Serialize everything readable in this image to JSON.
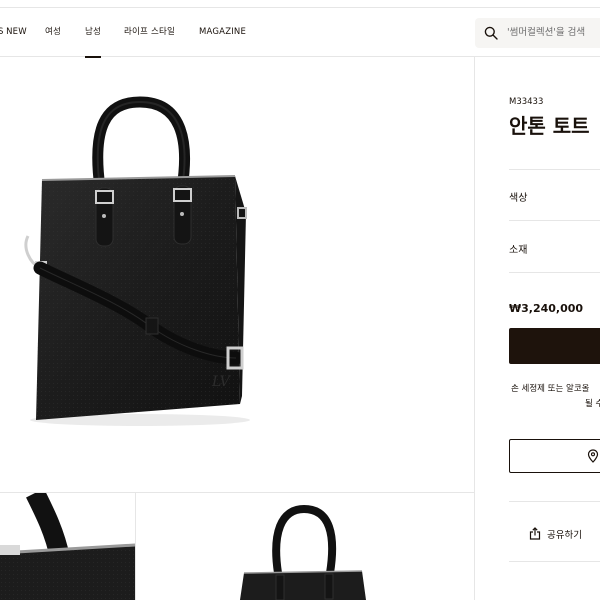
{
  "nav": {
    "items": [
      {
        "label": "NEW",
        "active": false
      },
      {
        "label": "여성",
        "active": false
      },
      {
        "label": "남성",
        "active": true
      },
      {
        "label": "라이프 스타일",
        "active": false
      },
      {
        "label": "MAGAZINE",
        "active": false
      }
    ]
  },
  "search": {
    "icon": "search-icon",
    "placeholder": "'썸머컬렉션'을 검색"
  },
  "product": {
    "sku": "M33433",
    "name": "안톤 토트",
    "color_label": "색상",
    "material_label": "소재",
    "price": "₩3,240,000",
    "note_line1": "손 세정제 또는 알코올",
    "note_line2": "될 수",
    "store_icon": "location-pin-icon",
    "share_label": "공유하기",
    "share_icon": "share-icon"
  },
  "colors": {
    "primary_dark": "#1e130c",
    "background": "#ffffff",
    "divider": "#e6e6e6",
    "search_bg": "#f6f5f3"
  }
}
